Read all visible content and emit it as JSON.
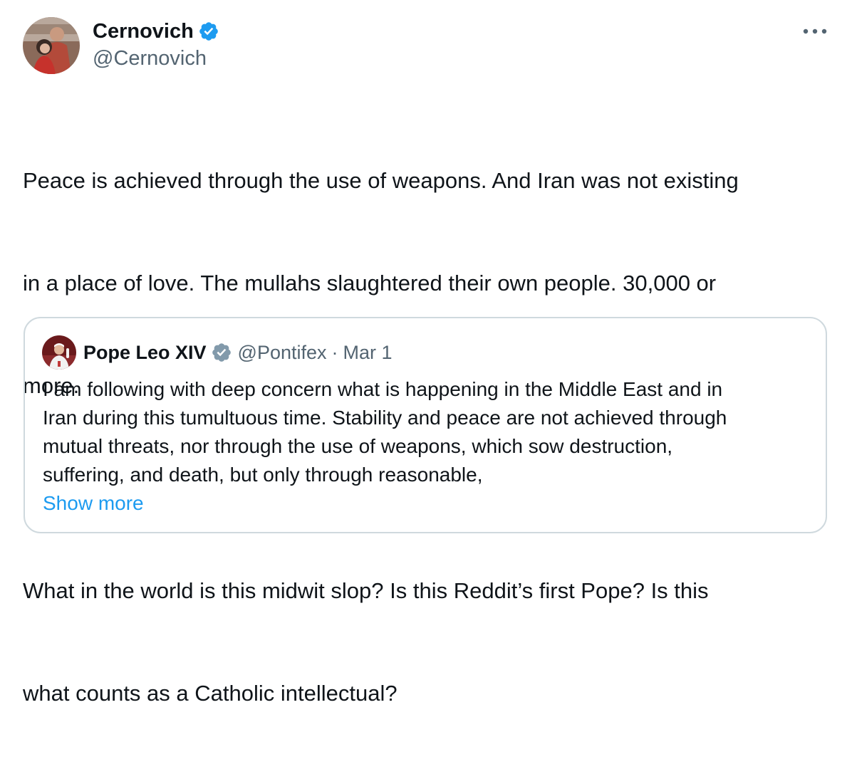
{
  "tweet": {
    "author": {
      "display_name": "Cernovich",
      "handle": "@Cernovich",
      "verified": true
    },
    "text_lines": [
      "Peace is achieved through the use of weapons. And Iran was not existing",
      "in a place of love. The mullahs slaughtered their own people. 30,000 or",
      "more.",
      "",
      "What in the world is this midwit slop? Is this Reddit’s first Pope? Is this",
      "what counts as a Catholic intellectual?"
    ],
    "more_icon": "more-horizontal-icon"
  },
  "quote": {
    "author": {
      "display_name": "Pope Leo XIV",
      "handle": "@Pontifex",
      "separator": "·",
      "date": "Mar 1",
      "verified_badge": "gray"
    },
    "text_lines": [
      "I am following with deep concern what is happening in the Middle East and in",
      "Iran during this tumultuous time. Stability and peace are not achieved through",
      "mutual threats, nor through the use of weapons, which sow destruction,",
      "suffering, and death, but only through reasonable,"
    ],
    "show_more": "Show more"
  },
  "colors": {
    "text_primary": "#0f1419",
    "text_secondary": "#536471",
    "link_blue": "#1d9bf0",
    "verified_blue": "#1d9bf0",
    "verified_gray": "#829aab",
    "quote_border": "#cfd9de"
  }
}
